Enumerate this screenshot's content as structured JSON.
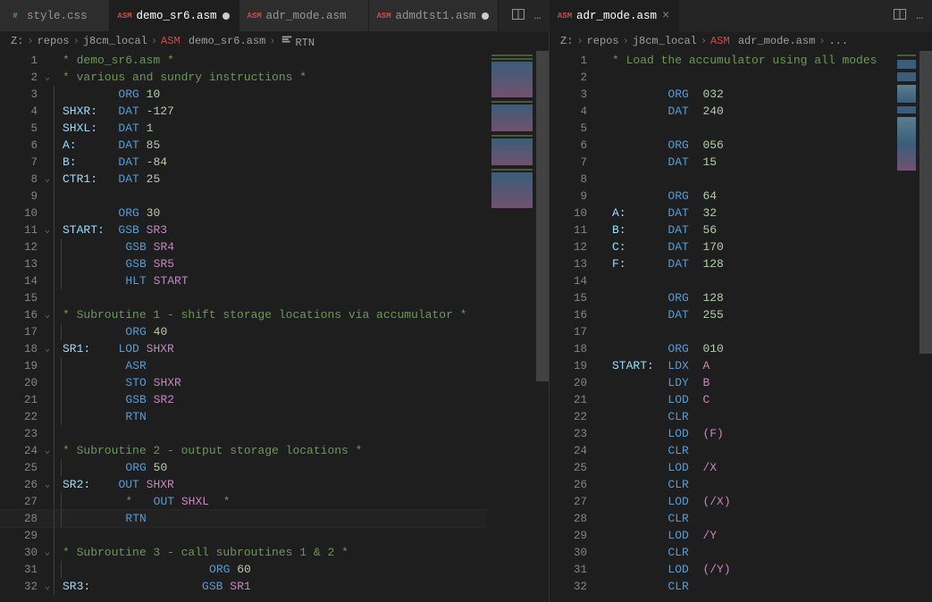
{
  "tabs": {
    "left": [
      {
        "icon": "css",
        "label": "style.css",
        "dirty": false,
        "active": false
      },
      {
        "icon": "asm",
        "label": "demo_sr6.asm",
        "dirty": true,
        "active": true
      },
      {
        "icon": "asm",
        "label": "adr_mode.asm",
        "dirty": false,
        "active": false
      },
      {
        "icon": "asm",
        "label": "admdtst1.asm",
        "dirty": true,
        "active": false
      }
    ],
    "right": [
      {
        "icon": "asm",
        "label": "adr_mode.asm",
        "dirty": false,
        "active": true
      }
    ],
    "action_split_icon": "split-editor-icon",
    "action_more_icon": "…"
  },
  "breadcrumbs": {
    "left": [
      "Z:",
      "repos",
      "j8cm_local",
      {
        "icon": "asm",
        "text": "demo_sr6.asm"
      },
      {
        "sym": true,
        "text": "RTN"
      }
    ],
    "right": [
      "Z:",
      "repos",
      "j8cm_local",
      {
        "icon": "asm",
        "text": "adr_mode.asm"
      },
      "..."
    ]
  },
  "editor_left": {
    "current_line": 28,
    "lines": [
      {
        "n": 1,
        "fold": "",
        "g": 0,
        "tok": [
          [
            "c-cmt",
            "* demo_sr6.asm *"
          ]
        ]
      },
      {
        "n": 2,
        "fold": "v",
        "g": 0,
        "tok": [
          [
            "c-cmt",
            "* various and sundry instructions *"
          ]
        ]
      },
      {
        "n": 3,
        "fold": "",
        "g": 1,
        "tok": [
          [
            "",
            "        "
          ],
          [
            "c-op",
            "ORG"
          ],
          [
            "",
            " "
          ],
          [
            "c-num",
            "10"
          ]
        ]
      },
      {
        "n": 4,
        "fold": "",
        "g": 1,
        "tok": [
          [
            "c-lbl",
            "SHXR:"
          ],
          [
            "",
            "   "
          ],
          [
            "c-op",
            "DAT"
          ],
          [
            "",
            " "
          ],
          [
            "c-num",
            "-127"
          ]
        ]
      },
      {
        "n": 5,
        "fold": "",
        "g": 1,
        "tok": [
          [
            "c-lbl",
            "SHXL:"
          ],
          [
            "",
            "   "
          ],
          [
            "c-op",
            "DAT"
          ],
          [
            "",
            " "
          ],
          [
            "c-num",
            "1"
          ]
        ]
      },
      {
        "n": 6,
        "fold": "",
        "g": 1,
        "tok": [
          [
            "c-lbl",
            "A:"
          ],
          [
            "",
            "      "
          ],
          [
            "c-op",
            "DAT"
          ],
          [
            "",
            " "
          ],
          [
            "c-num",
            "85"
          ]
        ]
      },
      {
        "n": 7,
        "fold": "",
        "g": 1,
        "tok": [
          [
            "c-lbl",
            "B:"
          ],
          [
            "",
            "      "
          ],
          [
            "c-op",
            "DAT"
          ],
          [
            "",
            " "
          ],
          [
            "c-num",
            "-84"
          ]
        ]
      },
      {
        "n": 8,
        "fold": "v",
        "g": 1,
        "tok": [
          [
            "c-lbl",
            "CTR1:"
          ],
          [
            "",
            "   "
          ],
          [
            "c-op",
            "DAT"
          ],
          [
            "",
            " "
          ],
          [
            "c-num",
            "25"
          ]
        ]
      },
      {
        "n": 9,
        "fold": "",
        "g": 1,
        "tok": []
      },
      {
        "n": 10,
        "fold": "",
        "g": 1,
        "tok": [
          [
            "",
            "        "
          ],
          [
            "c-op",
            "ORG"
          ],
          [
            "",
            " "
          ],
          [
            "c-num",
            "30"
          ]
        ]
      },
      {
        "n": 11,
        "fold": "v",
        "g": 1,
        "tok": [
          [
            "c-lbl",
            "START:"
          ],
          [
            "",
            "  "
          ],
          [
            "c-op",
            "GSB"
          ],
          [
            "",
            " "
          ],
          [
            "c-id",
            "SR3"
          ]
        ]
      },
      {
        "n": 12,
        "fold": "",
        "g": 2,
        "tok": [
          [
            "",
            "        "
          ],
          [
            "c-op",
            "GSB"
          ],
          [
            "",
            " "
          ],
          [
            "c-id",
            "SR4"
          ]
        ]
      },
      {
        "n": 13,
        "fold": "",
        "g": 2,
        "tok": [
          [
            "",
            "        "
          ],
          [
            "c-op",
            "GSB"
          ],
          [
            "",
            " "
          ],
          [
            "c-id",
            "SR5"
          ]
        ]
      },
      {
        "n": 14,
        "fold": "",
        "g": 2,
        "tok": [
          [
            "",
            "        "
          ],
          [
            "c-op",
            "HLT"
          ],
          [
            "",
            " "
          ],
          [
            "c-id",
            "START"
          ]
        ]
      },
      {
        "n": 15,
        "fold": "",
        "g": 1,
        "tok": []
      },
      {
        "n": 16,
        "fold": "v",
        "g": 1,
        "tok": [
          [
            "c-cmt",
            "* Subroutine 1 - shift storage locations via accumulator *"
          ]
        ]
      },
      {
        "n": 17,
        "fold": "",
        "g": 2,
        "tok": [
          [
            "",
            "        "
          ],
          [
            "c-op",
            "ORG"
          ],
          [
            "",
            " "
          ],
          [
            "c-num",
            "40"
          ]
        ]
      },
      {
        "n": 18,
        "fold": "v",
        "g": 1,
        "tok": [
          [
            "c-lbl",
            "SR1:"
          ],
          [
            "",
            "    "
          ],
          [
            "c-op",
            "LOD"
          ],
          [
            "",
            " "
          ],
          [
            "c-id",
            "SHXR"
          ]
        ]
      },
      {
        "n": 19,
        "fold": "",
        "g": 2,
        "tok": [
          [
            "",
            "        "
          ],
          [
            "c-op",
            "ASR"
          ]
        ]
      },
      {
        "n": 20,
        "fold": "",
        "g": 2,
        "tok": [
          [
            "",
            "        "
          ],
          [
            "c-op",
            "STO"
          ],
          [
            "",
            " "
          ],
          [
            "c-id",
            "SHXR"
          ]
        ]
      },
      {
        "n": 21,
        "fold": "",
        "g": 2,
        "tok": [
          [
            "",
            "        "
          ],
          [
            "c-op",
            "GSB"
          ],
          [
            "",
            " "
          ],
          [
            "c-id",
            "SR2"
          ]
        ]
      },
      {
        "n": 22,
        "fold": "",
        "g": 2,
        "tok": [
          [
            "",
            "        "
          ],
          [
            "c-op",
            "RTN"
          ]
        ]
      },
      {
        "n": 23,
        "fold": "",
        "g": 1,
        "tok": []
      },
      {
        "n": 24,
        "fold": "v",
        "g": 1,
        "tok": [
          [
            "c-cmt",
            "* Subroutine 2 - output storage locations *"
          ]
        ]
      },
      {
        "n": 25,
        "fold": "",
        "g": 2,
        "tok": [
          [
            "",
            "        "
          ],
          [
            "c-op",
            "ORG"
          ],
          [
            "",
            " "
          ],
          [
            "c-num",
            "50"
          ]
        ]
      },
      {
        "n": 26,
        "fold": "v",
        "g": 1,
        "tok": [
          [
            "c-lbl",
            "SR2:"
          ],
          [
            "",
            "    "
          ],
          [
            "c-op",
            "OUT"
          ],
          [
            "",
            " "
          ],
          [
            "c-id",
            "SHXR"
          ]
        ]
      },
      {
        "n": 27,
        "fold": "",
        "g": 2,
        "tok": [
          [
            "",
            "        "
          ],
          [
            "c-cmt",
            "*   "
          ],
          [
            "c-op",
            "OUT"
          ],
          [
            "",
            " "
          ],
          [
            "c-id",
            "SHXL"
          ],
          [
            "",
            "  "
          ],
          [
            "c-cmt",
            "*"
          ]
        ]
      },
      {
        "n": 28,
        "fold": "",
        "g": 2,
        "tok": [
          [
            "",
            "        "
          ],
          [
            "c-op",
            "RTN"
          ]
        ]
      },
      {
        "n": 29,
        "fold": "",
        "g": 1,
        "tok": []
      },
      {
        "n": 30,
        "fold": "v",
        "g": 1,
        "tok": [
          [
            "c-cmt",
            "* Subroutine 3 - call subroutines 1 & 2 *"
          ]
        ]
      },
      {
        "n": 31,
        "fold": "",
        "g": 2,
        "tok": [
          [
            "",
            "                    "
          ],
          [
            "c-op",
            "ORG"
          ],
          [
            "",
            " "
          ],
          [
            "c-num",
            "60"
          ]
        ]
      },
      {
        "n": 32,
        "fold": "v",
        "g": 1,
        "tok": [
          [
            "c-lbl",
            "SR3:"
          ],
          [
            "",
            "                "
          ],
          [
            "c-op",
            "GSB"
          ],
          [
            "",
            " "
          ],
          [
            "c-id",
            "SR1"
          ]
        ]
      }
    ]
  },
  "editor_right": {
    "lines": [
      {
        "n": 1,
        "tok": [
          [
            "c-cmt",
            "* Load the accumulator using all modes"
          ]
        ]
      },
      {
        "n": 2,
        "tok": []
      },
      {
        "n": 3,
        "tok": [
          [
            "",
            "        "
          ],
          [
            "c-op",
            "ORG"
          ],
          [
            "",
            "  "
          ],
          [
            "c-num",
            "032"
          ]
        ]
      },
      {
        "n": 4,
        "tok": [
          [
            "",
            "        "
          ],
          [
            "c-op",
            "DAT"
          ],
          [
            "",
            "  "
          ],
          [
            "c-num",
            "240"
          ]
        ]
      },
      {
        "n": 5,
        "tok": []
      },
      {
        "n": 6,
        "tok": [
          [
            "",
            "        "
          ],
          [
            "c-op",
            "ORG"
          ],
          [
            "",
            "  "
          ],
          [
            "c-num",
            "056"
          ]
        ]
      },
      {
        "n": 7,
        "tok": [
          [
            "",
            "        "
          ],
          [
            "c-op",
            "DAT"
          ],
          [
            "",
            "  "
          ],
          [
            "c-num",
            "15"
          ]
        ]
      },
      {
        "n": 8,
        "tok": []
      },
      {
        "n": 9,
        "tok": [
          [
            "",
            "        "
          ],
          [
            "c-op",
            "ORG"
          ],
          [
            "",
            "  "
          ],
          [
            "c-num",
            "64"
          ]
        ]
      },
      {
        "n": 10,
        "tok": [
          [
            "c-lbl",
            "A:"
          ],
          [
            "",
            "      "
          ],
          [
            "c-op",
            "DAT"
          ],
          [
            "",
            "  "
          ],
          [
            "c-num",
            "32"
          ]
        ]
      },
      {
        "n": 11,
        "tok": [
          [
            "c-lbl",
            "B:"
          ],
          [
            "",
            "      "
          ],
          [
            "c-op",
            "DAT"
          ],
          [
            "",
            "  "
          ],
          [
            "c-num",
            "56"
          ]
        ]
      },
      {
        "n": 12,
        "tok": [
          [
            "c-lbl",
            "C:"
          ],
          [
            "",
            "      "
          ],
          [
            "c-op",
            "DAT"
          ],
          [
            "",
            "  "
          ],
          [
            "c-num",
            "170"
          ]
        ]
      },
      {
        "n": 13,
        "tok": [
          [
            "c-lbl",
            "F:"
          ],
          [
            "",
            "      "
          ],
          [
            "c-op",
            "DAT"
          ],
          [
            "",
            "  "
          ],
          [
            "c-num",
            "128"
          ]
        ]
      },
      {
        "n": 14,
        "tok": []
      },
      {
        "n": 15,
        "tok": [
          [
            "",
            "        "
          ],
          [
            "c-op",
            "ORG"
          ],
          [
            "",
            "  "
          ],
          [
            "c-num",
            "128"
          ]
        ]
      },
      {
        "n": 16,
        "tok": [
          [
            "",
            "        "
          ],
          [
            "c-op",
            "DAT"
          ],
          [
            "",
            "  "
          ],
          [
            "c-num",
            "255"
          ]
        ]
      },
      {
        "n": 17,
        "tok": []
      },
      {
        "n": 18,
        "tok": [
          [
            "",
            "        "
          ],
          [
            "c-op",
            "ORG"
          ],
          [
            "",
            "  "
          ],
          [
            "c-num",
            "010"
          ]
        ]
      },
      {
        "n": 19,
        "tok": [
          [
            "c-lbl",
            "START:"
          ],
          [
            "",
            "  "
          ],
          [
            "c-op",
            "LDX"
          ],
          [
            "",
            "  "
          ],
          [
            "c-id",
            "A"
          ]
        ]
      },
      {
        "n": 20,
        "tok": [
          [
            "",
            "        "
          ],
          [
            "c-op",
            "LDY"
          ],
          [
            "",
            "  "
          ],
          [
            "c-id",
            "B"
          ]
        ]
      },
      {
        "n": 21,
        "tok": [
          [
            "",
            "        "
          ],
          [
            "c-op",
            "LOD"
          ],
          [
            "",
            "  "
          ],
          [
            "c-id",
            "C"
          ]
        ]
      },
      {
        "n": 22,
        "tok": [
          [
            "",
            "        "
          ],
          [
            "c-op",
            "CLR"
          ]
        ]
      },
      {
        "n": 23,
        "tok": [
          [
            "",
            "        "
          ],
          [
            "c-op",
            "LOD"
          ],
          [
            "",
            "  "
          ],
          [
            "c-id",
            "(F)"
          ]
        ]
      },
      {
        "n": 24,
        "tok": [
          [
            "",
            "        "
          ],
          [
            "c-op",
            "CLR"
          ]
        ]
      },
      {
        "n": 25,
        "tok": [
          [
            "",
            "        "
          ],
          [
            "c-op",
            "LOD"
          ],
          [
            "",
            "  "
          ],
          [
            "c-id",
            "/X"
          ]
        ]
      },
      {
        "n": 26,
        "tok": [
          [
            "",
            "        "
          ],
          [
            "c-op",
            "CLR"
          ]
        ]
      },
      {
        "n": 27,
        "tok": [
          [
            "",
            "        "
          ],
          [
            "c-op",
            "LOD"
          ],
          [
            "",
            "  "
          ],
          [
            "c-id",
            "(/X)"
          ]
        ]
      },
      {
        "n": 28,
        "tok": [
          [
            "",
            "        "
          ],
          [
            "c-op",
            "CLR"
          ]
        ]
      },
      {
        "n": 29,
        "tok": [
          [
            "",
            "        "
          ],
          [
            "c-op",
            "LOD"
          ],
          [
            "",
            "  "
          ],
          [
            "c-id",
            "/Y"
          ]
        ]
      },
      {
        "n": 30,
        "tok": [
          [
            "",
            "        "
          ],
          [
            "c-op",
            "CLR"
          ]
        ]
      },
      {
        "n": 31,
        "tok": [
          [
            "",
            "        "
          ],
          [
            "c-op",
            "LOD"
          ],
          [
            "",
            "  "
          ],
          [
            "c-id",
            "(/Y)"
          ]
        ]
      },
      {
        "n": 32,
        "tok": [
          [
            "",
            "        "
          ],
          [
            "c-op",
            "CLR"
          ]
        ]
      }
    ]
  }
}
